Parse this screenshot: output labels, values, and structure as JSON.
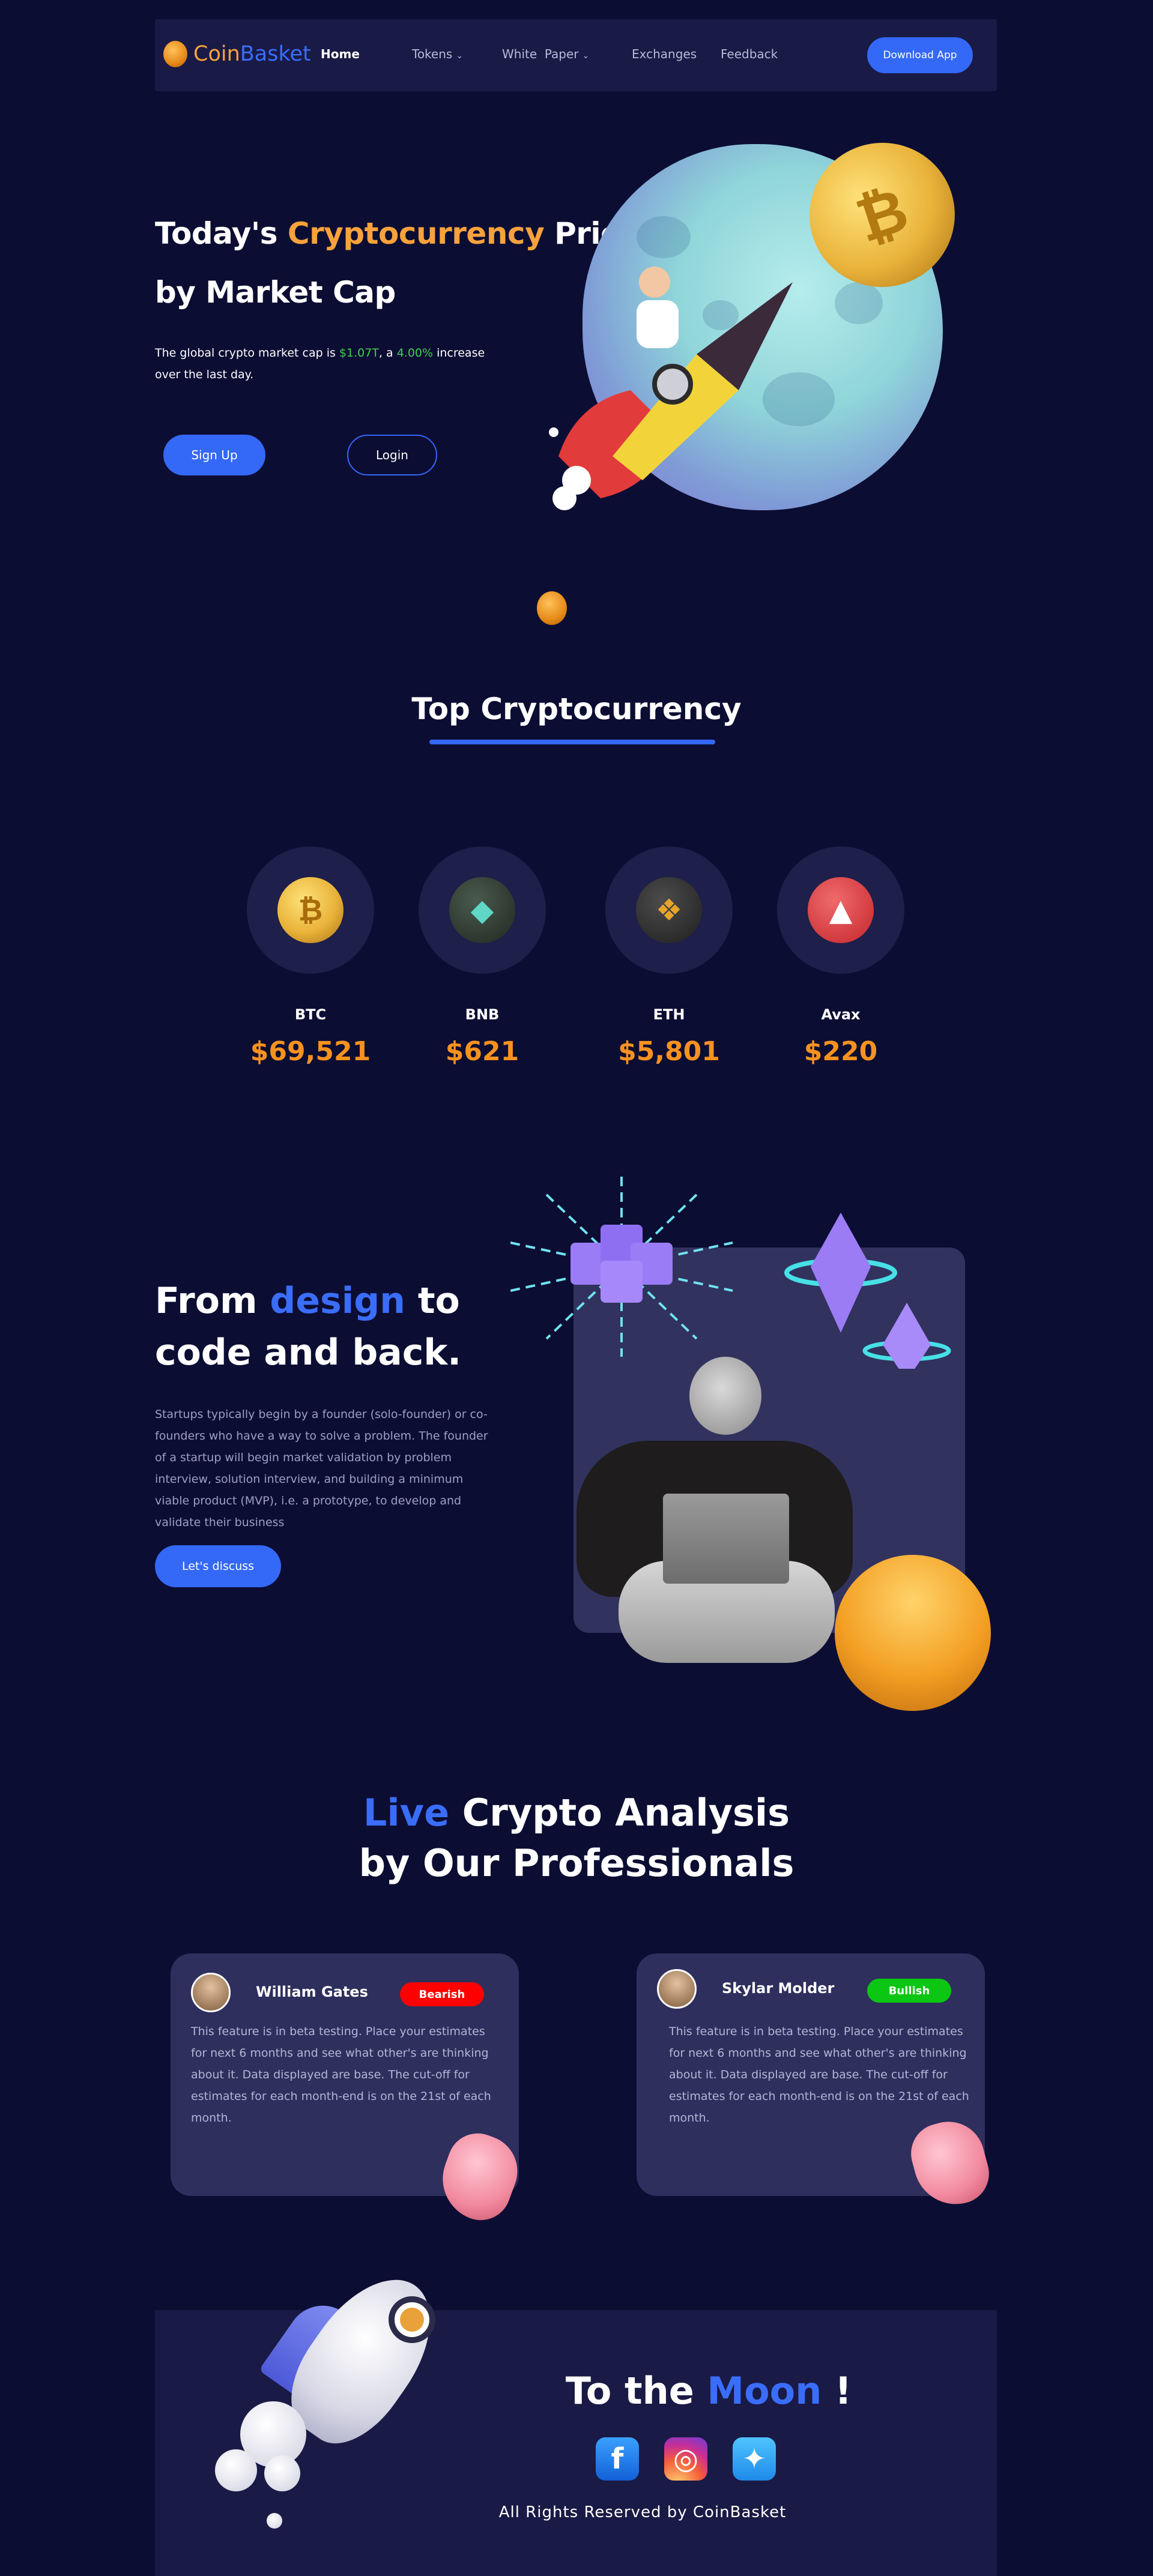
{
  "brand": {
    "part1": "Coin",
    "part2": "Basket"
  },
  "nav": {
    "home": "Home",
    "tokens": "Tokens",
    "white_paper": "White  Paper",
    "exchanges": "Exchanges",
    "feedback": "Feedback",
    "download": "Download App"
  },
  "hero": {
    "title_prefix": "Today's ",
    "title_highlight": "Cryptocurrency",
    "title_suffix": " Prices",
    "title_line2": "by Market Cap",
    "desc_pre": "The global crypto market cap is ",
    "desc_cap": "$1.07T",
    "desc_mid": ", a ",
    "desc_pct": "4.00%",
    "desc_post": " increase over the last day.",
    "signup": "Sign Up",
    "login": "Login"
  },
  "top": {
    "title": "Top Cryptocurrency",
    "coins": [
      {
        "name": "BTC",
        "price": "$69,521"
      },
      {
        "name": "BNB",
        "price": "$621"
      },
      {
        "name": "ETH",
        "price": "$5,801"
      },
      {
        "name": "Avax",
        "price": "$220"
      }
    ]
  },
  "design": {
    "title_pre": "From ",
    "title_hl": "design",
    "title_post": " to",
    "title_line2": "code and back.",
    "desc": "Startups typically begin by a founder (solo-founder) or co-founders who have a way to solve a problem. The founder of a startup will begin market validation by problem interview, solution interview, and building a minimum viable product (MVP), i.e. a prototype, to develop and validate their business",
    "cta": "Let's discuss"
  },
  "live": {
    "title_hl": "Live",
    "title_post": " Crypto Analysis",
    "title_line2": "by Our Professionals",
    "cards": [
      {
        "name": "William Gates",
        "badge": "Bearish",
        "text": "This feature is in beta testing. Place your estimates for next 6 months and see what other's are thinking about it. Data displayed are base. The cut-off for estimates for each month-end is on the 21st of each month."
      },
      {
        "name": "Skylar Molder",
        "badge": "Bullish",
        "text": "This feature is in beta testing. Place your estimates for next 6 months and see what other's are thinking about it. Data displayed are base. The cut-off for estimates for each month-end is on the 21st of each month."
      }
    ]
  },
  "footer": {
    "title_pre": "To the ",
    "title_hl": "Moon",
    "title_post": " !",
    "copyright": "All Rights Reserved by CoinBasket"
  },
  "colors": {
    "accent": "#3468f6",
    "orange": "#f7a23c",
    "bearish": "#ff0000",
    "bullish": "#0bc613",
    "background": "#0c0d33"
  },
  "icons": [
    "coin-logo-icon",
    "chevron-down-icon",
    "bitcoin-icon",
    "bnb-icon",
    "eth-icon",
    "avax-icon",
    "facebook-icon",
    "instagram-icon",
    "twitter-icon"
  ]
}
